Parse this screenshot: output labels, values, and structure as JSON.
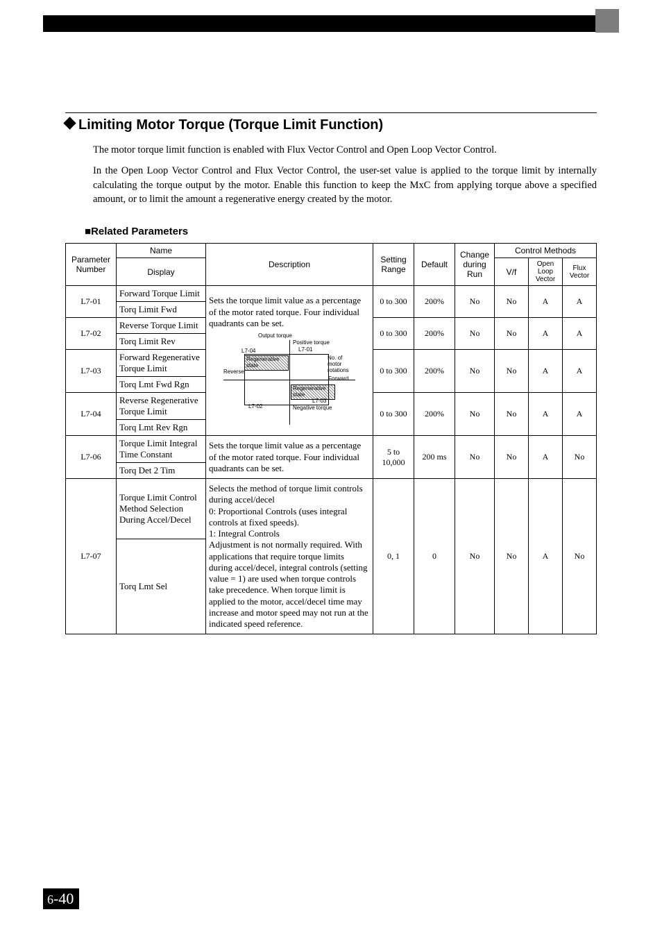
{
  "section": {
    "title": "Limiting Motor Torque (Torque Limit Function)",
    "p1": "The motor torque limit function is enabled with Flux Vector Control and Open Loop Vector Control.",
    "p2": "In the Open Loop Vector Control and Flux Vector Control, the user-set value is applied to the torque limit by internally calculating the torque output by the motor. Enable this function to keep the MxC from applying torque above a specified amount, or to limit the amount a regenerative energy created by the motor."
  },
  "sub": {
    "related": "Related Parameters"
  },
  "headers": {
    "paramNumber": "Parameter Number",
    "name": "Name",
    "display": "Display",
    "description": "Description",
    "settingRange": "Setting Range",
    "default": "Default",
    "change": "Change during Run",
    "controlMethods": "Control Methods",
    "vf": "V/f",
    "openLoop": "Open Loop Vector",
    "flux": "Flux Vector"
  },
  "desc": {
    "shared1": "Sets the torque limit value as a percentage of the motor rated torque. Four individual quadrants can be set.",
    "l706": "Sets the torque limit value as a percentage of the motor rated torque. Four individual quadrants can be set.",
    "l707a": "Selects the method of torque limit controls during accel/decel",
    "l707b": "0:  Proportional Controls (uses integral controls at fixed speeds).",
    "l707c": "1:  Integral Controls",
    "l707d": "Adjustment is not normally required. With applications that require torque limits during accel/decel, integral controls (setting value = 1) are used when torque controls take precedence. When torque limit is applied to the motor, accel/decel time may increase and motor speed may not run at the indicated speed reference."
  },
  "diagram": {
    "outputTorque": "Output torque",
    "positiveTorque": "Positive torque",
    "negativeTorque": "Negative torque",
    "forward": "Forward",
    "reverse": "Reverse",
    "regen": "Regenerative state",
    "noRot": "No. of motor rotations",
    "l701": "L7-01",
    "l702": "L7-02",
    "l703": "L7-03",
    "l704": "L7-04"
  },
  "rows": [
    {
      "num": "L7-01",
      "nameTop": "Forward Torque Limit",
      "nameBottom": "Torq Limit Fwd",
      "range": "0 to 300",
      "default": "200%",
      "change": "No",
      "vf": "No",
      "olv": "A",
      "flux": "A"
    },
    {
      "num": "L7-02",
      "nameTop": "Reverse Torque Limit",
      "nameBottom": "Torq Limit Rev",
      "range": "0 to 300",
      "default": "200%",
      "change": "No",
      "vf": "No",
      "olv": "A",
      "flux": "A"
    },
    {
      "num": "L7-03",
      "nameTop": "Forward Regenerative Torque Limit",
      "nameBottom": "Torq Lmt Fwd Rgn",
      "range": "0 to 300",
      "default": "200%",
      "change": "No",
      "vf": "No",
      "olv": "A",
      "flux": "A"
    },
    {
      "num": "L7-04",
      "nameTop": "Reverse Regenerative Torque Limit",
      "nameBottom": "Torq Lmt Rev Rgn",
      "range": "0 to 300",
      "default": "200%",
      "change": "No",
      "vf": "No",
      "olv": "A",
      "flux": "A"
    },
    {
      "num": "L7-06",
      "nameTop": "Torque Limit Integral Time Constant",
      "nameBottom": "Torq Det 2 Tim",
      "range": "5 to 10,000",
      "default": "200 ms",
      "change": "No",
      "vf": "No",
      "olv": "A",
      "flux": "No"
    },
    {
      "num": "L7-07",
      "nameTop": "Torque Limit Control Method Selection During Accel/Decel",
      "nameBottom": "Torq Lmt Sel",
      "range": "0, 1",
      "default": "0",
      "change": "No",
      "vf": "No",
      "olv": "A",
      "flux": "No"
    }
  ],
  "pageNumber": {
    "chapter": "6",
    "page": "40"
  }
}
